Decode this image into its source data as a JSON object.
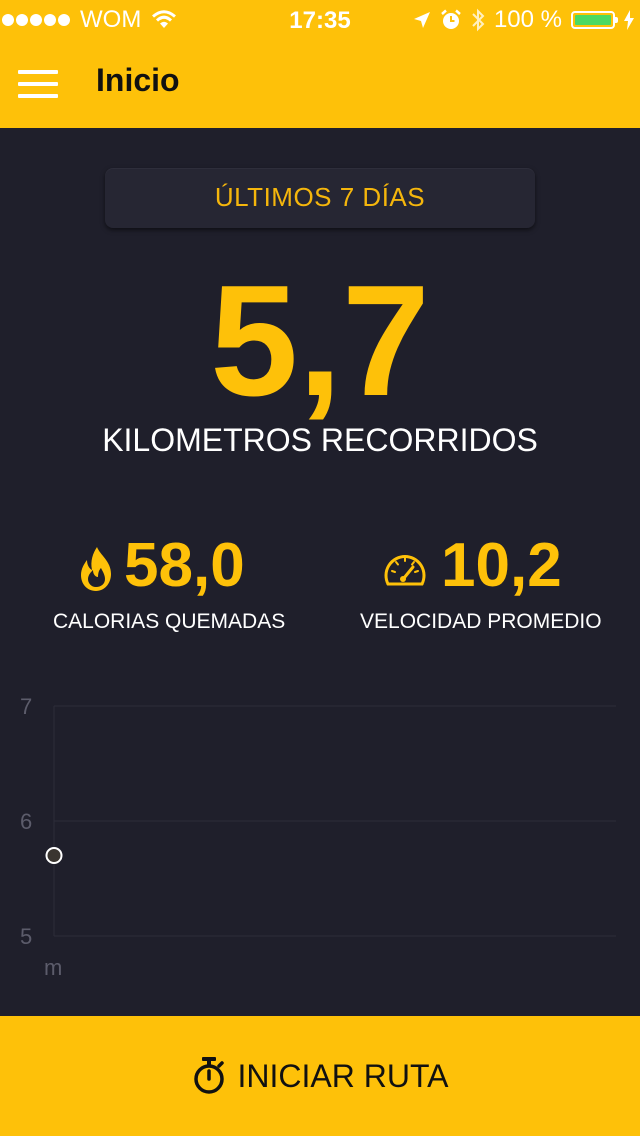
{
  "status_bar": {
    "carrier": "WOM",
    "time": "17:35",
    "battery": "100 %",
    "battery_level": 1.0
  },
  "nav": {
    "title": "Inicio"
  },
  "range_selector": {
    "label": "ÚLTIMOS 7 DÍAS"
  },
  "distance": {
    "value": "5,7",
    "label": "KILOMETROS RECORRIDOS"
  },
  "calories": {
    "value": "58,0",
    "label": "CALORIAS QUEMADAS",
    "icon": "flame-icon"
  },
  "speed": {
    "value": "10,2",
    "label": "VELOCIDAD PROMEDIO",
    "icon": "speedometer-icon"
  },
  "chart_data": {
    "type": "scatter",
    "y_ticks": [
      "7",
      "6",
      "5"
    ],
    "ylim": [
      5,
      7
    ],
    "unit_label": "m",
    "grid": true,
    "points": [
      {
        "y": 5.7
      }
    ]
  },
  "cta": {
    "label": "INICIAR RUTA",
    "icon": "stopwatch-icon"
  },
  "colors": {
    "accent": "#fec109",
    "background": "#1f1f2b"
  }
}
